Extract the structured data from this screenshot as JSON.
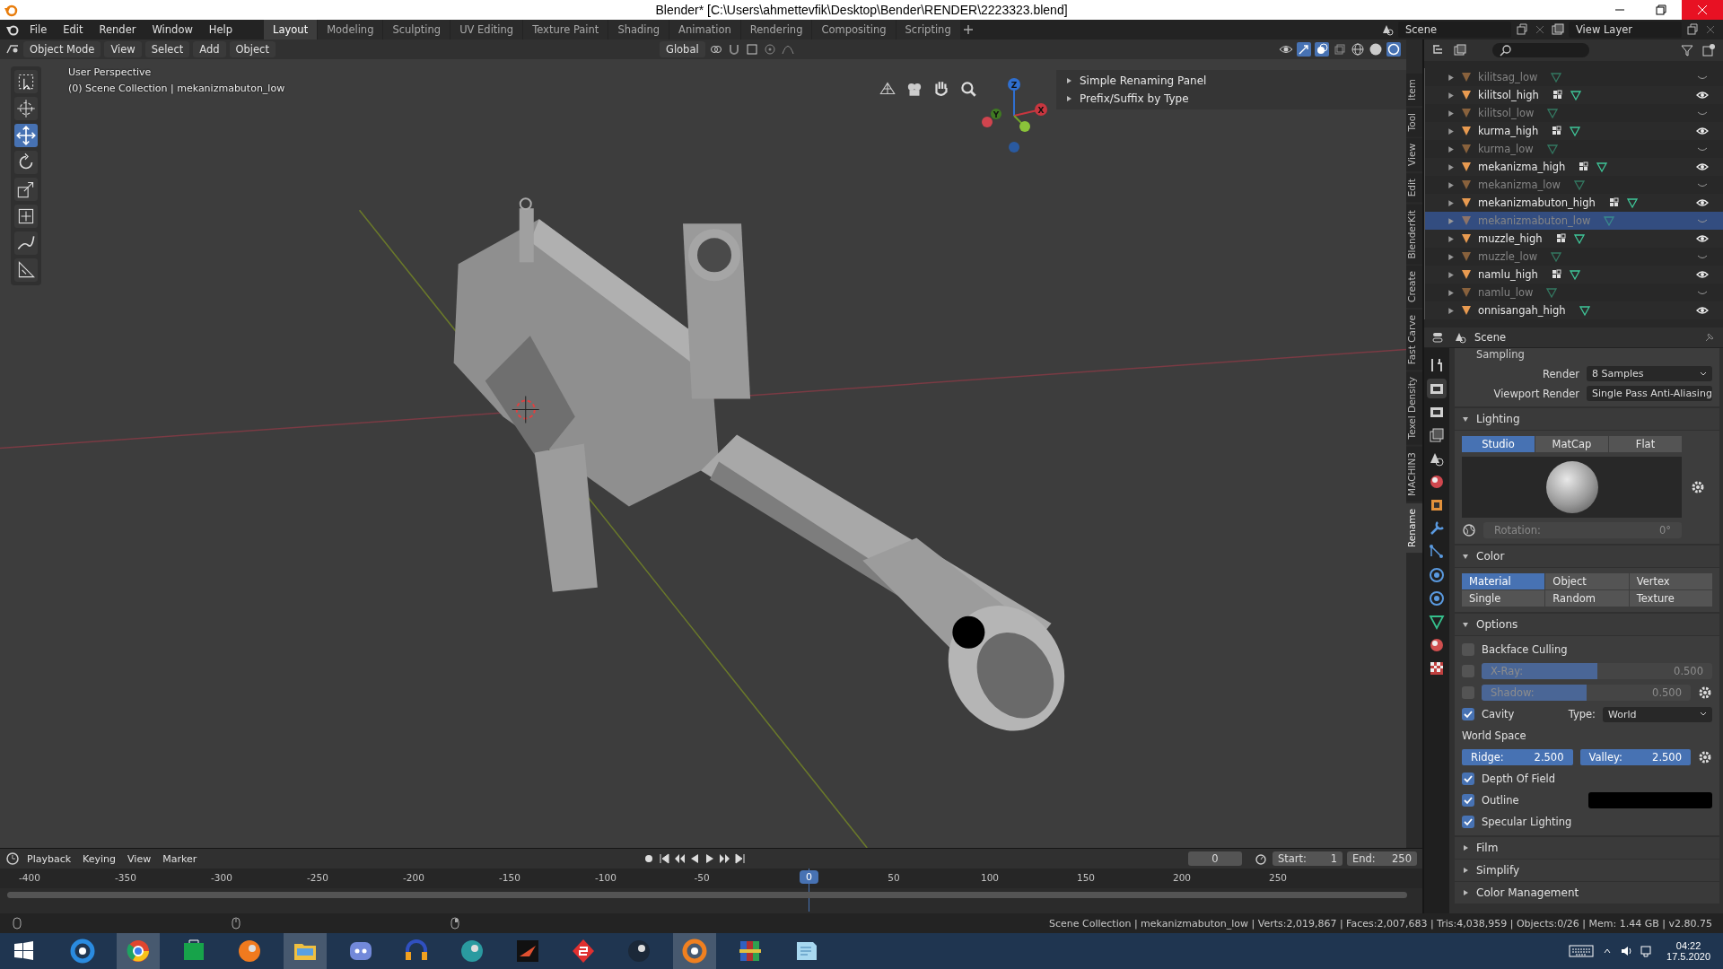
{
  "window": {
    "title": "Blender* [C:\\Users\\ahmettevfik\\Desktop\\Bender\\RENDER\\2223323.blend]"
  },
  "menu": [
    "File",
    "Edit",
    "Render",
    "Window",
    "Help"
  ],
  "workspaces": [
    {
      "label": "Layout",
      "selected": true
    },
    {
      "label": "Modeling",
      "selected": false
    },
    {
      "label": "Sculpting",
      "selected": false
    },
    {
      "label": "UV Editing",
      "selected": false
    },
    {
      "label": "Texture Paint",
      "selected": false
    },
    {
      "label": "Shading",
      "selected": false
    },
    {
      "label": "Animation",
      "selected": false
    },
    {
      "label": "Rendering",
      "selected": false
    },
    {
      "label": "Compositing",
      "selected": false
    },
    {
      "label": "Scripting",
      "selected": false
    }
  ],
  "scene": "Scene",
  "view_layer": "View Layer",
  "viewport": {
    "mode": "Object Mode",
    "menus": [
      "View",
      "Select",
      "Add",
      "Object"
    ],
    "orientation": "Global",
    "perspective": "User Perspective",
    "collection": "(0) Scene Collection | mekanizmabuton_low",
    "tools": [
      {
        "kind": "select",
        "selected": false
      },
      {
        "kind": "cursor",
        "selected": false
      },
      {
        "kind": "move",
        "selected": true
      },
      {
        "kind": "rotate",
        "selected": false
      },
      {
        "kind": "scale",
        "selected": false
      },
      {
        "kind": "transform",
        "selected": false
      },
      {
        "kind": "annotate",
        "selected": false
      },
      {
        "kind": "measure",
        "selected": false
      }
    ],
    "gizmo_axes": [
      "X",
      "Y",
      "Z"
    ],
    "panels": [
      "Simple Renaming Panel",
      "Prefix/Suffix by Type"
    ],
    "sidebar_tabs": [
      {
        "label": "Item",
        "selected": false
      },
      {
        "label": "Tool",
        "selected": false
      },
      {
        "label": "View",
        "selected": false
      },
      {
        "label": "Edit",
        "selected": false
      },
      {
        "label": "BlenderKit",
        "selected": false
      },
      {
        "label": "Create",
        "selected": false
      },
      {
        "label": "Fast Carve",
        "selected": false
      },
      {
        "label": "Texel Density",
        "selected": false
      },
      {
        "label": "MACHIN3",
        "selected": false
      },
      {
        "label": "Rename",
        "selected": true
      }
    ]
  },
  "outliner": {
    "items": [
      {
        "name": "kilitsag_low",
        "visible": false,
        "modifier": false,
        "selected": false
      },
      {
        "name": "kilitsol_high",
        "visible": true,
        "modifier": true,
        "selected": false
      },
      {
        "name": "kilitsol_low",
        "visible": false,
        "modifier": false,
        "selected": false
      },
      {
        "name": "kurma_high",
        "visible": true,
        "modifier": true,
        "selected": false
      },
      {
        "name": "kurma_low",
        "visible": false,
        "modifier": false,
        "selected": false
      },
      {
        "name": "mekanizma_high",
        "visible": true,
        "modifier": true,
        "selected": false
      },
      {
        "name": "mekanizma_low",
        "visible": false,
        "modifier": false,
        "selected": false
      },
      {
        "name": "mekanizmabuton_high",
        "visible": true,
        "modifier": true,
        "selected": false
      },
      {
        "name": "mekanizmabuton_low",
        "visible": false,
        "modifier": false,
        "selected": true
      },
      {
        "name": "muzzle_high",
        "visible": true,
        "modifier": true,
        "selected": false
      },
      {
        "name": "muzzle_low",
        "visible": false,
        "modifier": false,
        "selected": false
      },
      {
        "name": "namlu_high",
        "visible": true,
        "modifier": true,
        "selected": false
      },
      {
        "name": "namlu_low",
        "visible": false,
        "modifier": false,
        "selected": false
      },
      {
        "name": "onnisangah_high",
        "visible": true,
        "modifier": false,
        "selected": false
      }
    ]
  },
  "properties": {
    "context": "Scene",
    "tabs": [
      {
        "kind": "tool",
        "selected": false
      },
      {
        "kind": "render",
        "selected": true
      },
      {
        "kind": "output",
        "selected": false
      },
      {
        "kind": "view_layer",
        "selected": false
      },
      {
        "kind": "scene",
        "selected": false
      },
      {
        "kind": "world",
        "selected": false
      },
      {
        "kind": "object",
        "selected": false
      },
      {
        "kind": "modifier",
        "selected": false
      },
      {
        "kind": "particles",
        "selected": false
      },
      {
        "kind": "physics",
        "selected": false
      },
      {
        "kind": "constraints",
        "selected": false
      },
      {
        "kind": "data",
        "selected": false
      },
      {
        "kind": "material",
        "selected": false
      },
      {
        "kind": "texture",
        "selected": false
      }
    ],
    "sampling": "Sampling",
    "render_label": "Render",
    "render_value": "8 Samples",
    "viewport_render_label": "Viewport Render",
    "viewport_render_value": "Single Pass Anti-Aliasing",
    "lighting": {
      "title": "Lighting",
      "modes": [
        {
          "label": "Studio",
          "selected": true
        },
        {
          "label": "MatCap",
          "selected": false
        },
        {
          "label": "Flat",
          "selected": false
        }
      ],
      "rotation_label": "Rotation:",
      "rotation_value": "0°"
    },
    "color": {
      "title": "Color",
      "options": [
        {
          "label": "Material",
          "selected": true
        },
        {
          "label": "Object",
          "selected": false
        },
        {
          "label": "Vertex",
          "selected": false
        },
        {
          "label": "Single",
          "selected": false
        },
        {
          "label": "Random",
          "selected": false
        },
        {
          "label": "Texture",
          "selected": false
        }
      ]
    },
    "options": {
      "title": "Options",
      "backface": {
        "label": "Backface Culling",
        "checked": false
      },
      "xray": {
        "label": "X-Ray:",
        "value": "0.500",
        "level": 0.5,
        "checked": false
      },
      "shadow": {
        "label": "Shadow:",
        "value": "0.500",
        "level": 0.5,
        "checked": false
      },
      "cavity": {
        "label": "Cavity",
        "checked": true,
        "type_label": "Type:",
        "type_value": "World"
      },
      "world_space": "World Space",
      "ridge": {
        "label": "Ridge:",
        "value": "2.500"
      },
      "valley": {
        "label": "Valley:",
        "value": "2.500"
      },
      "dof": {
        "label": "Depth Of Field",
        "checked": true
      },
      "outline": {
        "label": "Outline",
        "checked": true,
        "color": "#000000"
      },
      "specular": {
        "label": "Specular Lighting",
        "checked": true
      }
    },
    "collapsed": [
      "Film",
      "Simplify",
      "Color Management"
    ]
  },
  "timeline": {
    "menus": [
      "Playback",
      "Keying",
      "View",
      "Marker"
    ],
    "current_frame": "0",
    "start_label": "Start:",
    "start": "1",
    "end_label": "End:",
    "end": "250",
    "ruler": [
      "-400",
      "-350",
      "-300",
      "-250",
      "-200",
      "-150",
      "-100",
      "-50",
      "50",
      "100",
      "150",
      "200",
      "250"
    ],
    "playhead": "0"
  },
  "status_bar": "Scene Collection | mekanizmabuton_low | Verts:2,019,867 | Faces:2,007,683 | Tris:4,038,959 | Objects:0/26 | Mem: 1.44 GB | v2.80.75",
  "taskbar": {
    "apps": [
      {
        "kind": "ring",
        "selected": false
      },
      {
        "kind": "wheel",
        "selected": true
      },
      {
        "kind": "bag",
        "selected": false
      },
      {
        "kind": "flame",
        "selected": false
      },
      {
        "kind": "folder",
        "selected": true
      },
      {
        "kind": "chat",
        "selected": false
      },
      {
        "kind": "headphones",
        "selected": false
      },
      {
        "kind": "disc",
        "selected": false
      },
      {
        "kind": "arrow",
        "selected": false
      },
      {
        "kind": "diamond",
        "selected": false
      },
      {
        "kind": "steam",
        "selected": false
      },
      {
        "kind": "orbit",
        "selected": true
      },
      {
        "kind": "books",
        "selected": false
      },
      {
        "kind": "notepad",
        "selected": false
      }
    ],
    "time": "04:22",
    "date": "17.5.2020"
  }
}
